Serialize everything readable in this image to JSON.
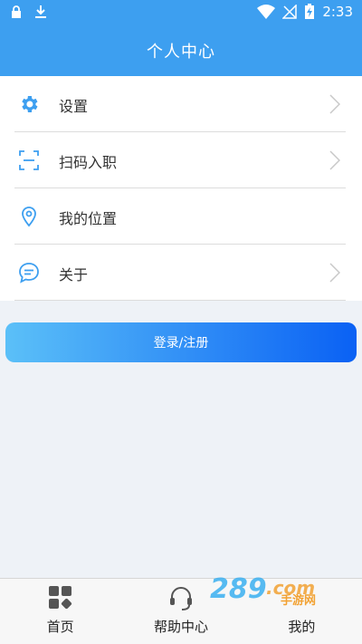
{
  "status_bar": {
    "time": "2:33",
    "icons": [
      "lock-icon",
      "download-icon",
      "wifi-icon",
      "no-signal-icon",
      "battery-charging-icon"
    ]
  },
  "header": {
    "title": "个人中心"
  },
  "menu": {
    "items": [
      {
        "label": "设置",
        "icon": "gear-icon",
        "has_chevron": true
      },
      {
        "label": "扫码入职",
        "icon": "scan-icon",
        "has_chevron": true
      },
      {
        "label": "我的位置",
        "icon": "location-pin-icon",
        "has_chevron": false
      },
      {
        "label": "关于",
        "icon": "chat-bubble-icon",
        "has_chevron": true
      }
    ]
  },
  "login_button": {
    "label": "登录/注册"
  },
  "bottom_nav": {
    "items": [
      {
        "label": "首页",
        "icon": "grid-icon"
      },
      {
        "label": "帮助中心",
        "icon": "headset-icon"
      },
      {
        "label": "我的",
        "icon": ""
      }
    ]
  },
  "watermark": {
    "text": "手游网"
  },
  "colors": {
    "header": "#3d9ff0",
    "icon_blue": "#3d9ff0",
    "button_start": "#5bc0f8",
    "button_end": "#0a61f4",
    "background": "#eef2f7"
  }
}
